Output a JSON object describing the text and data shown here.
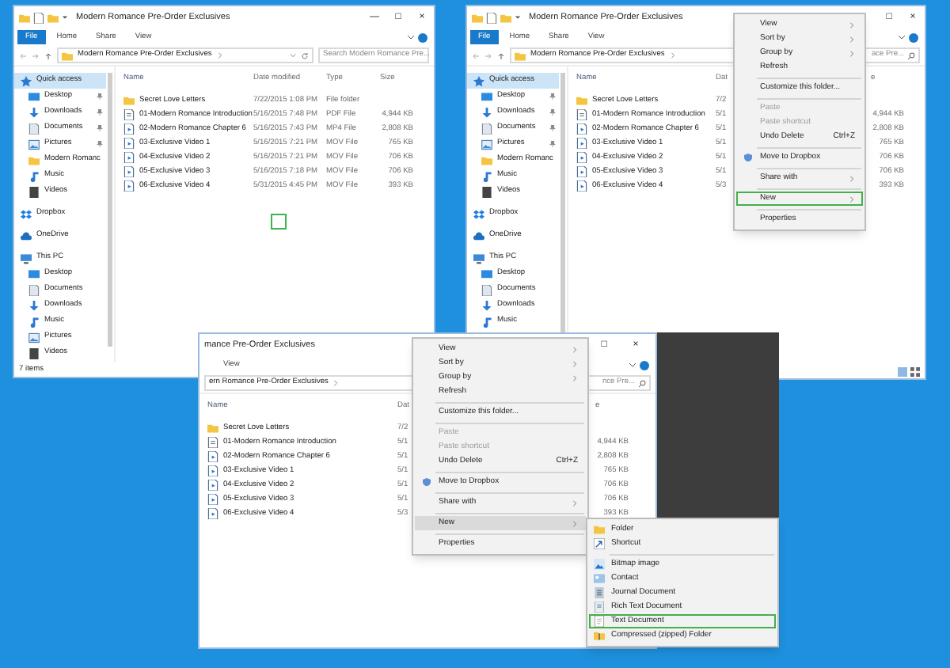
{
  "windows": [
    {
      "title": "Modern Romance Pre-Order Exclusives",
      "controls": [
        "—",
        "□",
        "×"
      ],
      "ribbon": [
        {
          "label": "File",
          "kind": "file"
        },
        {
          "label": "Home",
          "kind": "tab"
        },
        {
          "label": "Share",
          "kind": "tab"
        },
        {
          "label": "View",
          "kind": "tab"
        }
      ],
      "address": "Modern Romance Pre-Order Exclusives",
      "search": {
        "placeholder": "Search Modern Romance Pre..."
      },
      "nav": [
        {
          "label": "Quick access",
          "kind": "star",
          "selected": true,
          "pinned": false,
          "children": [
            {
              "label": "Desktop",
              "kind": "desktop",
              "selected": false,
              "pinned": true
            },
            {
              "label": "Downloads",
              "kind": "download",
              "selected": false,
              "pinned": true
            },
            {
              "label": "Documents",
              "kind": "document",
              "selected": false,
              "pinned": true
            },
            {
              "label": "Pictures",
              "kind": "picture",
              "selected": false,
              "pinned": true
            },
            {
              "label": "Modern Romanc",
              "kind": "folder",
              "selected": false,
              "pinned": false
            },
            {
              "label": "Music",
              "kind": "music",
              "selected": false,
              "pinned": false
            },
            {
              "label": "Videos",
              "kind": "video",
              "selected": false,
              "pinned": false
            }
          ]
        },
        {
          "label": "Dropbox",
          "kind": "dropbox",
          "selected": false,
          "pinned": false
        },
        {
          "label": "OneDrive",
          "kind": "cloud",
          "selected": false,
          "pinned": false
        },
        {
          "label": "This PC",
          "kind": "pc",
          "selected": false,
          "pinned": false,
          "children": [
            {
              "label": "Desktop",
              "kind": "desktop",
              "selected": false,
              "pinned": false
            },
            {
              "label": "Documents",
              "kind": "document",
              "selected": false,
              "pinned": false
            },
            {
              "label": "Downloads",
              "kind": "download",
              "selected": false,
              "pinned": false
            },
            {
              "label": "Music",
              "kind": "music",
              "selected": false,
              "pinned": false
            },
            {
              "label": "Pictures",
              "kind": "picture",
              "selected": false,
              "pinned": false
            },
            {
              "label": "Videos",
              "kind": "video",
              "selected": false,
              "pinned": false
            }
          ]
        }
      ],
      "header": {
        "name": "Name",
        "date": "Date modified",
        "type": "Type",
        "size": "Size"
      },
      "rows": [
        {
          "kind": "folder",
          "name": "Secret Love Letters",
          "date": "7/22/2015 1:08 PM",
          "type": "File folder"
        },
        {
          "kind": "pdf",
          "name": "01-Modern Romance Introduction",
          "date": "5/16/2015 7:48 PM",
          "type": "PDF File",
          "size": "4,944 KB"
        },
        {
          "kind": "video",
          "name": "02-Modern Romance Chapter 6",
          "date": "5/16/2015 7:43 PM",
          "type": "MP4 File",
          "size": "2,808 KB"
        },
        {
          "kind": "video",
          "name": "03-Exclusive Video 1",
          "date": "5/16/2015 7:21 PM",
          "type": "MOV File",
          "size": "765 KB"
        },
        {
          "kind": "video",
          "name": "04-Exclusive Video 2",
          "date": "5/16/2015 7:21 PM",
          "type": "MOV File",
          "size": "706 KB"
        },
        {
          "kind": "video",
          "name": "05-Exclusive Video 3",
          "date": "5/16/2015 7:18 PM",
          "type": "MOV File",
          "size": "706 KB"
        },
        {
          "kind": "video",
          "name": "06-Exclusive Video 4",
          "date": "5/31/2015 4:45 PM",
          "type": "MOV File",
          "size": "393 KB"
        }
      ],
      "selection_box": true,
      "status": "7 items"
    },
    {
      "title": "Modern Romance Pre-Order Exclusives",
      "controls": [
        "□",
        "×"
      ],
      "ribbon": [
        {
          "label": "File",
          "kind": "file"
        },
        {
          "label": "Home",
          "kind": "tab"
        },
        {
          "label": "Share",
          "kind": "tab"
        },
        {
          "label": "View",
          "kind": "tab"
        }
      ],
      "address": "Modern Romance Pre-Order Exclusives",
      "search": {
        "placeholder": "ace Pre..."
      },
      "nav": [
        {
          "label": "Quick access",
          "kind": "star",
          "selected": true,
          "pinned": false,
          "children": [
            {
              "label": "Desktop",
              "kind": "desktop",
              "selected": false,
              "pinned": true
            },
            {
              "label": "Downloads",
              "kind": "download",
              "selected": false,
              "pinned": true
            },
            {
              "label": "Documents",
              "kind": "document",
              "selected": false,
              "pinned": true
            },
            {
              "label": "Pictures",
              "kind": "picture",
              "selected": false,
              "pinned": true
            },
            {
              "label": "Modern Romanc",
              "kind": "folder",
              "selected": false,
              "pinned": false
            },
            {
              "label": "Music",
              "kind": "music",
              "selected": false,
              "pinned": false
            },
            {
              "label": "Videos",
              "kind": "video",
              "selected": false,
              "pinned": false
            }
          ]
        },
        {
          "label": "Dropbox",
          "kind": "dropbox",
          "selected": false,
          "pinned": false
        },
        {
          "label": "OneDrive",
          "kind": "cloud",
          "selected": false,
          "pinned": false
        },
        {
          "label": "This PC",
          "kind": "pc",
          "selected": false,
          "pinned": false,
          "children": [
            {
              "label": "Desktop",
              "kind": "desktop",
              "selected": false,
              "pinned": false
            },
            {
              "label": "Documents",
              "kind": "document",
              "selected": false,
              "pinned": false
            },
            {
              "label": "Downloads",
              "kind": "download",
              "selected": false,
              "pinned": false
            },
            {
              "label": "Music",
              "kind": "music",
              "selected": false,
              "pinned": false
            }
          ]
        }
      ],
      "header": {
        "name": "Name",
        "date": "Dat",
        "size": "e"
      },
      "rows": [
        {
          "kind": "folder",
          "name": "Secret Love Letters",
          "date": "7/2"
        },
        {
          "kind": "pdf",
          "name": "01-Modern Romance Introduction",
          "date": "5/1",
          "size": "4,944 KB"
        },
        {
          "kind": "video",
          "name": "02-Modern Romance Chapter 6",
          "date": "5/1",
          "size": "2,808 KB"
        },
        {
          "kind": "video",
          "name": "03-Exclusive Video 1",
          "date": "5/1",
          "size": "765 KB"
        },
        {
          "kind": "video",
          "name": "04-Exclusive Video 2",
          "date": "5/1",
          "size": "706 KB"
        },
        {
          "kind": "video",
          "name": "05-Exclusive Video 3",
          "date": "5/1",
          "size": "706 KB"
        },
        {
          "kind": "video",
          "name": "06-Exclusive Video 4",
          "date": "5/3",
          "size": "393 KB"
        }
      ],
      "selection_box": false,
      "menu": {
        "items": [
          {
            "kind": "item",
            "label": "View",
            "submenu": true,
            "disabled": false,
            "outlined": false,
            "hover": false
          },
          {
            "kind": "item",
            "label": "Sort by",
            "submenu": true,
            "disabled": false,
            "outlined": false,
            "hover": false
          },
          {
            "kind": "item",
            "label": "Group by",
            "submenu": true,
            "disabled": false,
            "outlined": false,
            "hover": false
          },
          {
            "kind": "item",
            "label": "Refresh",
            "submenu": false,
            "disabled": false,
            "outlined": false,
            "hover": false
          },
          {
            "kind": "separator"
          },
          {
            "kind": "item",
            "label": "Customize this folder...",
            "submenu": false,
            "disabled": false,
            "outlined": false,
            "hover": false
          },
          {
            "kind": "separator"
          },
          {
            "kind": "item",
            "label": "Paste",
            "submenu": false,
            "disabled": true,
            "outlined": false,
            "hover": false
          },
          {
            "kind": "item",
            "label": "Paste shortcut",
            "submenu": false,
            "disabled": true,
            "outlined": false,
            "hover": false
          },
          {
            "kind": "item",
            "label": "Undo Delete",
            "shortcut": "Ctrl+Z",
            "submenu": false,
            "disabled": false,
            "outlined": false,
            "hover": false
          },
          {
            "kind": "separator"
          },
          {
            "kind": "brand",
            "label": "Move to Dropbox",
            "submenu": false,
            "disabled": false,
            "outlined": false,
            "hover": false
          },
          {
            "kind": "separator"
          },
          {
            "kind": "item",
            "label": "Share with",
            "submenu": true,
            "disabled": false,
            "outlined": false,
            "hover": false
          },
          {
            "kind": "separator"
          },
          {
            "kind": "item",
            "label": "New",
            "submenu": true,
            "disabled": false,
            "outlined": true,
            "hover": false
          },
          {
            "kind": "separator"
          },
          {
            "kind": "item",
            "label": "Properties",
            "submenu": false,
            "disabled": false,
            "outlined": false,
            "hover": false
          }
        ]
      }
    },
    {
      "title": "mance Pre-Order Exclusives",
      "controls": [
        "□",
        "×"
      ],
      "ribbon": [
        {
          "label": "View",
          "kind": "tab"
        }
      ],
      "address": "ern Romance Pre-Order Exclusives",
      "search": {
        "placeholder": "nce Pre..."
      },
      "header": {
        "name": "Name",
        "date": "Dat",
        "size": "e"
      },
      "rows": [
        {
          "kind": "folder",
          "name": "Secret Love Letters",
          "date": "7/2"
        },
        {
          "kind": "pdf",
          "name": "01-Modern Romance Introduction",
          "date": "5/1",
          "size": "4,944 KB"
        },
        {
          "kind": "video",
          "name": "02-Modern Romance Chapter 6",
          "date": "5/1",
          "size": "2,808 KB"
        },
        {
          "kind": "video",
          "name": "03-Exclusive Video 1",
          "date": "5/1",
          "size": "765 KB"
        },
        {
          "kind": "video",
          "name": "04-Exclusive Video 2",
          "date": "5/1",
          "size": "706 KB"
        },
        {
          "kind": "video",
          "name": "05-Exclusive Video 3",
          "date": "5/1",
          "size": "706 KB"
        },
        {
          "kind": "video",
          "name": "06-Exclusive Video 4",
          "date": "5/3",
          "size": "393 KB"
        }
      ],
      "selection_box": false,
      "menu": {
        "items": [
          {
            "kind": "item",
            "label": "View",
            "submenu": true,
            "disabled": false,
            "outlined": false,
            "hover": false
          },
          {
            "kind": "item",
            "label": "Sort by",
            "submenu": true,
            "disabled": false,
            "outlined": false,
            "hover": false
          },
          {
            "kind": "item",
            "label": "Group by",
            "submenu": true,
            "disabled": false,
            "outlined": false,
            "hover": false
          },
          {
            "kind": "item",
            "label": "Refresh",
            "submenu": false,
            "disabled": false,
            "outlined": false,
            "hover": false
          },
          {
            "kind": "separator"
          },
          {
            "kind": "item",
            "label": "Customize this folder...",
            "submenu": false,
            "disabled": false,
            "outlined": false,
            "hover": false
          },
          {
            "kind": "separator"
          },
          {
            "kind": "item",
            "label": "Paste",
            "submenu": false,
            "disabled": true,
            "outlined": false,
            "hover": false
          },
          {
            "kind": "item",
            "label": "Paste shortcut",
            "submenu": false,
            "disabled": true,
            "outlined": false,
            "hover": false
          },
          {
            "kind": "item",
            "label": "Undo Delete",
            "shortcut": "Ctrl+Z",
            "submenu": false,
            "disabled": false,
            "outlined": false,
            "hover": false
          },
          {
            "kind": "separator"
          },
          {
            "kind": "brand",
            "label": "Move to Dropbox",
            "submenu": false,
            "disabled": false,
            "outlined": false,
            "hover": false
          },
          {
            "kind": "separator"
          },
          {
            "kind": "item",
            "label": "Share with",
            "submenu": true,
            "disabled": false,
            "outlined": false,
            "hover": false
          },
          {
            "kind": "separator"
          },
          {
            "kind": "item",
            "label": "New",
            "submenu": true,
            "disabled": false,
            "outlined": false,
            "hover": true
          },
          {
            "kind": "separator"
          },
          {
            "kind": "item",
            "label": "Properties",
            "submenu": false,
            "disabled": false,
            "outlined": false,
            "hover": false
          }
        ]
      },
      "submenu": {
        "items": [
          {
            "kind": "folder",
            "label": "Folder",
            "outlined": false
          },
          {
            "kind": "shortcut",
            "label": "Shortcut",
            "outlined": false
          },
          {
            "kind": "separator"
          },
          {
            "kind": "bitmap",
            "label": "Bitmap image",
            "outlined": false
          },
          {
            "kind": "contact",
            "label": "Contact",
            "outlined": false
          },
          {
            "kind": "journal",
            "label": "Journal Document",
            "outlined": false
          },
          {
            "kind": "richtext",
            "label": "Rich Text Document",
            "outlined": false
          },
          {
            "kind": "text",
            "label": "Text Document",
            "outlined": true
          },
          {
            "kind": "zip",
            "label": "Compressed (zipped) Folder",
            "outlined": false
          }
        ]
      }
    }
  ]
}
